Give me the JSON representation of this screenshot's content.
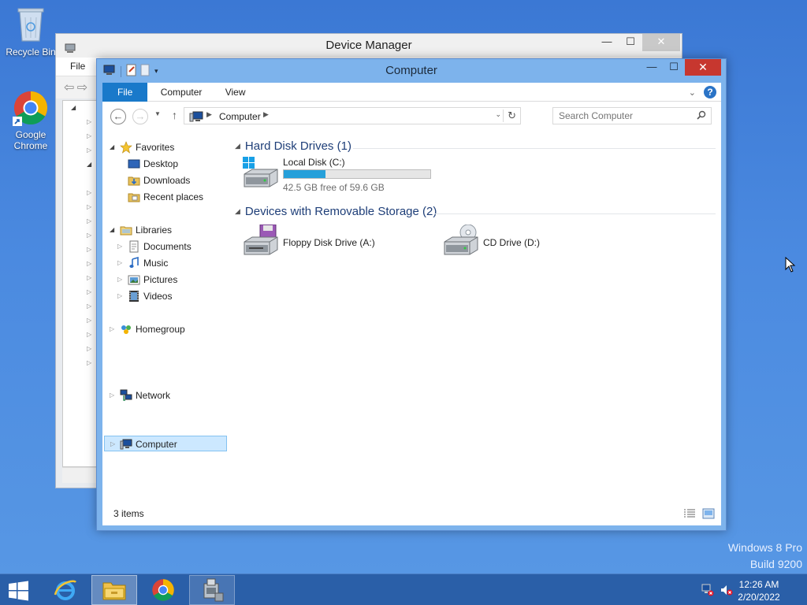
{
  "desktop": {
    "icons": [
      {
        "label": "Recycle Bin"
      },
      {
        "label": "Google Chrome"
      }
    ],
    "watermark": {
      "line1": "Windows 8 Pro",
      "line2": "Build 9200"
    }
  },
  "device_manager": {
    "title": "Device Manager",
    "menu": {
      "file": "File"
    },
    "buttons": {
      "minimize": "—",
      "maximize": "☐",
      "close": "✕"
    }
  },
  "explorer": {
    "title": "Computer",
    "buttons": {
      "minimize": "—",
      "maximize": "☐",
      "close": "✕"
    },
    "ribbon": {
      "tabs": [
        "File",
        "Computer",
        "View"
      ],
      "help": "?"
    },
    "address": {
      "crumb": "Computer"
    },
    "search": {
      "placeholder": "Search Computer"
    },
    "nav": {
      "favorites": "Favorites",
      "desktop": "Desktop",
      "downloads": "Downloads",
      "recent": "Recent places",
      "libraries": "Libraries",
      "documents": "Documents",
      "music": "Music",
      "pictures": "Pictures",
      "videos": "Videos",
      "homegroup": "Homegroup",
      "computer": "Computer",
      "network": "Network"
    },
    "groups": {
      "hdd": "Hard Disk Drives (1)",
      "removable": "Devices with Removable Storage (2)"
    },
    "drives": {
      "local": {
        "name": "Local Disk (C:)",
        "free_text": "42.5 GB free of 59.6 GB",
        "used_fraction": 0.287
      },
      "floppy": {
        "name": "Floppy Disk Drive (A:)"
      },
      "cd": {
        "name": "CD Drive (D:)"
      }
    },
    "status": {
      "count": "3 items"
    }
  },
  "taskbar": {
    "clock": {
      "time": "12:26 AM",
      "date": "2/20/2022"
    }
  },
  "colors": {
    "accent": "#1979ca",
    "progress": "#26a0da",
    "close": "#c7372f"
  }
}
